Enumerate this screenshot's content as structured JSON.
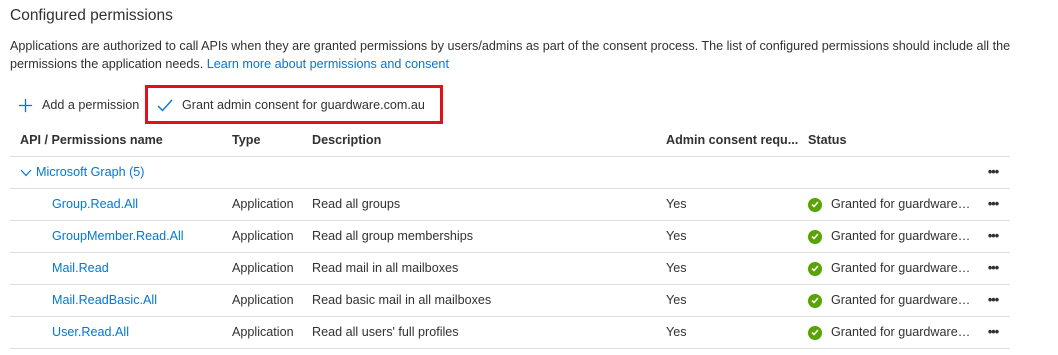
{
  "section": {
    "title": "Configured permissions",
    "description": "Applications are authorized to call APIs when they are granted permissions by users/admins as part of the consent process. The list of configured permissions should include all the permissions the application needs.",
    "learn_more_link": "Learn more about permissions and consent"
  },
  "toolbar": {
    "add_permission_label": "Add a permission",
    "add_icon": "plus-icon",
    "grant_consent_label": "Grant admin consent for guardware.com.au",
    "grant_icon": "checkmark-icon",
    "highlight_color": "#e3101b"
  },
  "table": {
    "headers": {
      "name": "API / Permissions name",
      "type": "Type",
      "description": "Description",
      "admin_consent": "Admin consent requ...",
      "status": "Status"
    },
    "group": {
      "label": "Microsoft Graph (5)",
      "expanded": true,
      "more_icon": "more-ellipsis-icon"
    },
    "rows": [
      {
        "name": "Group.Read.All",
        "type": "Application",
        "description": "Read all groups",
        "admin_consent": "Yes",
        "status": "Granted for guardware.c..."
      },
      {
        "name": "GroupMember.Read.All",
        "type": "Application",
        "description": "Read all group memberships",
        "admin_consent": "Yes",
        "status": "Granted for guardware.c..."
      },
      {
        "name": "Mail.Read",
        "type": "Application",
        "description": "Read mail in all mailboxes",
        "admin_consent": "Yes",
        "status": "Granted for guardware.c..."
      },
      {
        "name": "Mail.ReadBasic.All",
        "type": "Application",
        "description": "Read basic mail in all mailboxes",
        "admin_consent": "Yes",
        "status": "Granted for guardware.c..."
      },
      {
        "name": "User.Read.All",
        "type": "Application",
        "description": "Read all users' full profiles",
        "admin_consent": "Yes",
        "status": "Granted for guardware.c..."
      }
    ],
    "more_label": "•••"
  },
  "colors": {
    "link": "#0078d4",
    "success": "#57a300",
    "text": "#323130",
    "divider": "#e1dfdd"
  }
}
